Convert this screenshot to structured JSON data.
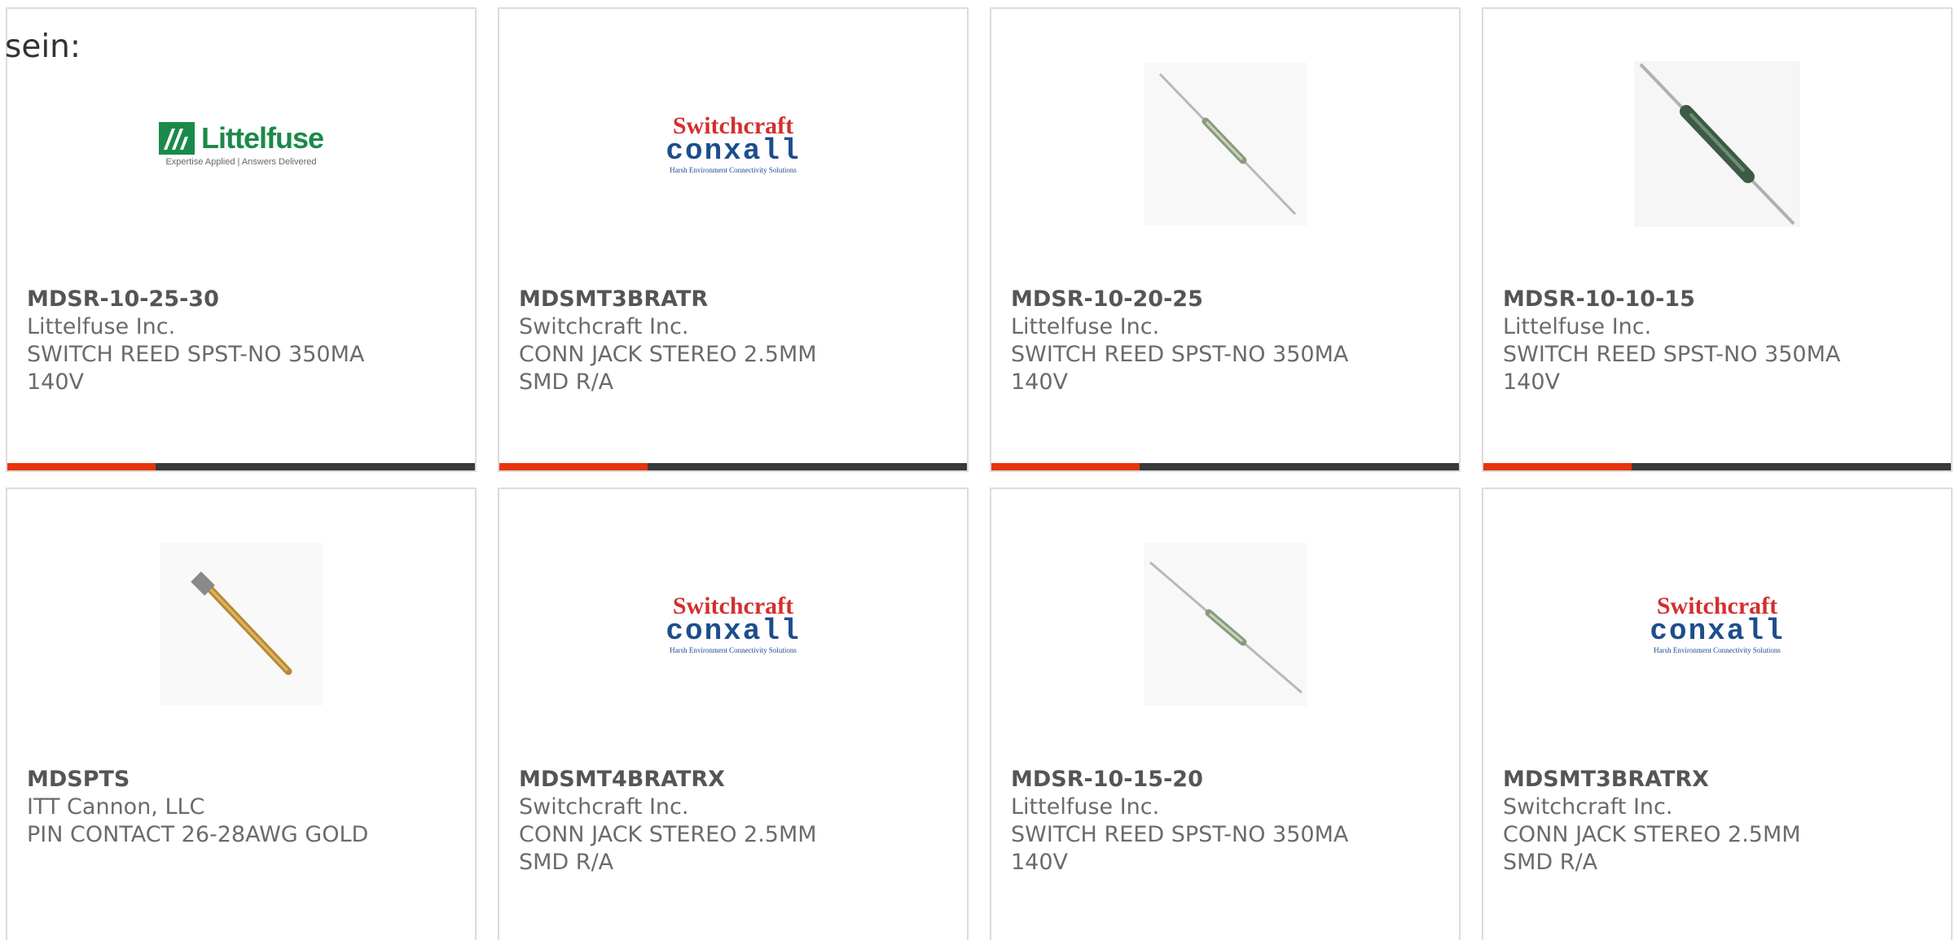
{
  "intro_text": "sein:",
  "colors": {
    "accent": "#e8340c",
    "bar": "#3a3a3a",
    "border": "#dcdcdc",
    "littelfuse_green": "#1a8a4a",
    "switchcraft_red": "#d32f2f",
    "conxall_blue": "#1d4e8c"
  },
  "logos": {
    "littelfuse": {
      "name": "Littelfuse",
      "tagline": "Expertise Applied | Answers Delivered"
    },
    "switchcraft": {
      "top": "Switchcraft",
      "mid": "conxall",
      "tagline": "Harsh Environment Connectivity Solutions"
    }
  },
  "products": [
    {
      "part_number": "MDSR-10-25-30",
      "manufacturer": "Littelfuse Inc.",
      "description": "SWITCH REED SPST-NO 350MA 140V",
      "image": "littelfuse-logo"
    },
    {
      "part_number": "MDSMT3BRATR",
      "manufacturer": "Switchcraft Inc.",
      "description": "CONN JACK STEREO 2.5MM SMD R/A",
      "image": "switchcraft-logo"
    },
    {
      "part_number": "MDSR-10-20-25",
      "manufacturer": "Littelfuse Inc.",
      "description": "SWITCH REED SPST-NO 350MA 140V",
      "image": "reed-switch-photo"
    },
    {
      "part_number": "MDSR-10-10-15",
      "manufacturer": "Littelfuse Inc.",
      "description": "SWITCH REED SPST-NO 350MA 140V",
      "image": "reed-switch-dark-photo"
    },
    {
      "part_number": "MDSPTS",
      "manufacturer": "ITT Cannon, LLC",
      "description": "PIN CONTACT 26-28AWG GOLD",
      "image": "pin-contact-photo"
    },
    {
      "part_number": "MDSMT4BRATRX",
      "manufacturer": "Switchcraft Inc.",
      "description": "CONN JACK STEREO 2.5MM SMD R/A",
      "image": "switchcraft-logo"
    },
    {
      "part_number": "MDSR-10-15-20",
      "manufacturer": "Littelfuse Inc.",
      "description": "SWITCH REED SPST-NO 350MA 140V",
      "image": "reed-switch-photo"
    },
    {
      "part_number": "MDSMT3BRATRX",
      "manufacturer": "Switchcraft Inc.",
      "description": "CONN JACK STEREO 2.5MM SMD R/A",
      "image": "switchcraft-logo"
    }
  ]
}
